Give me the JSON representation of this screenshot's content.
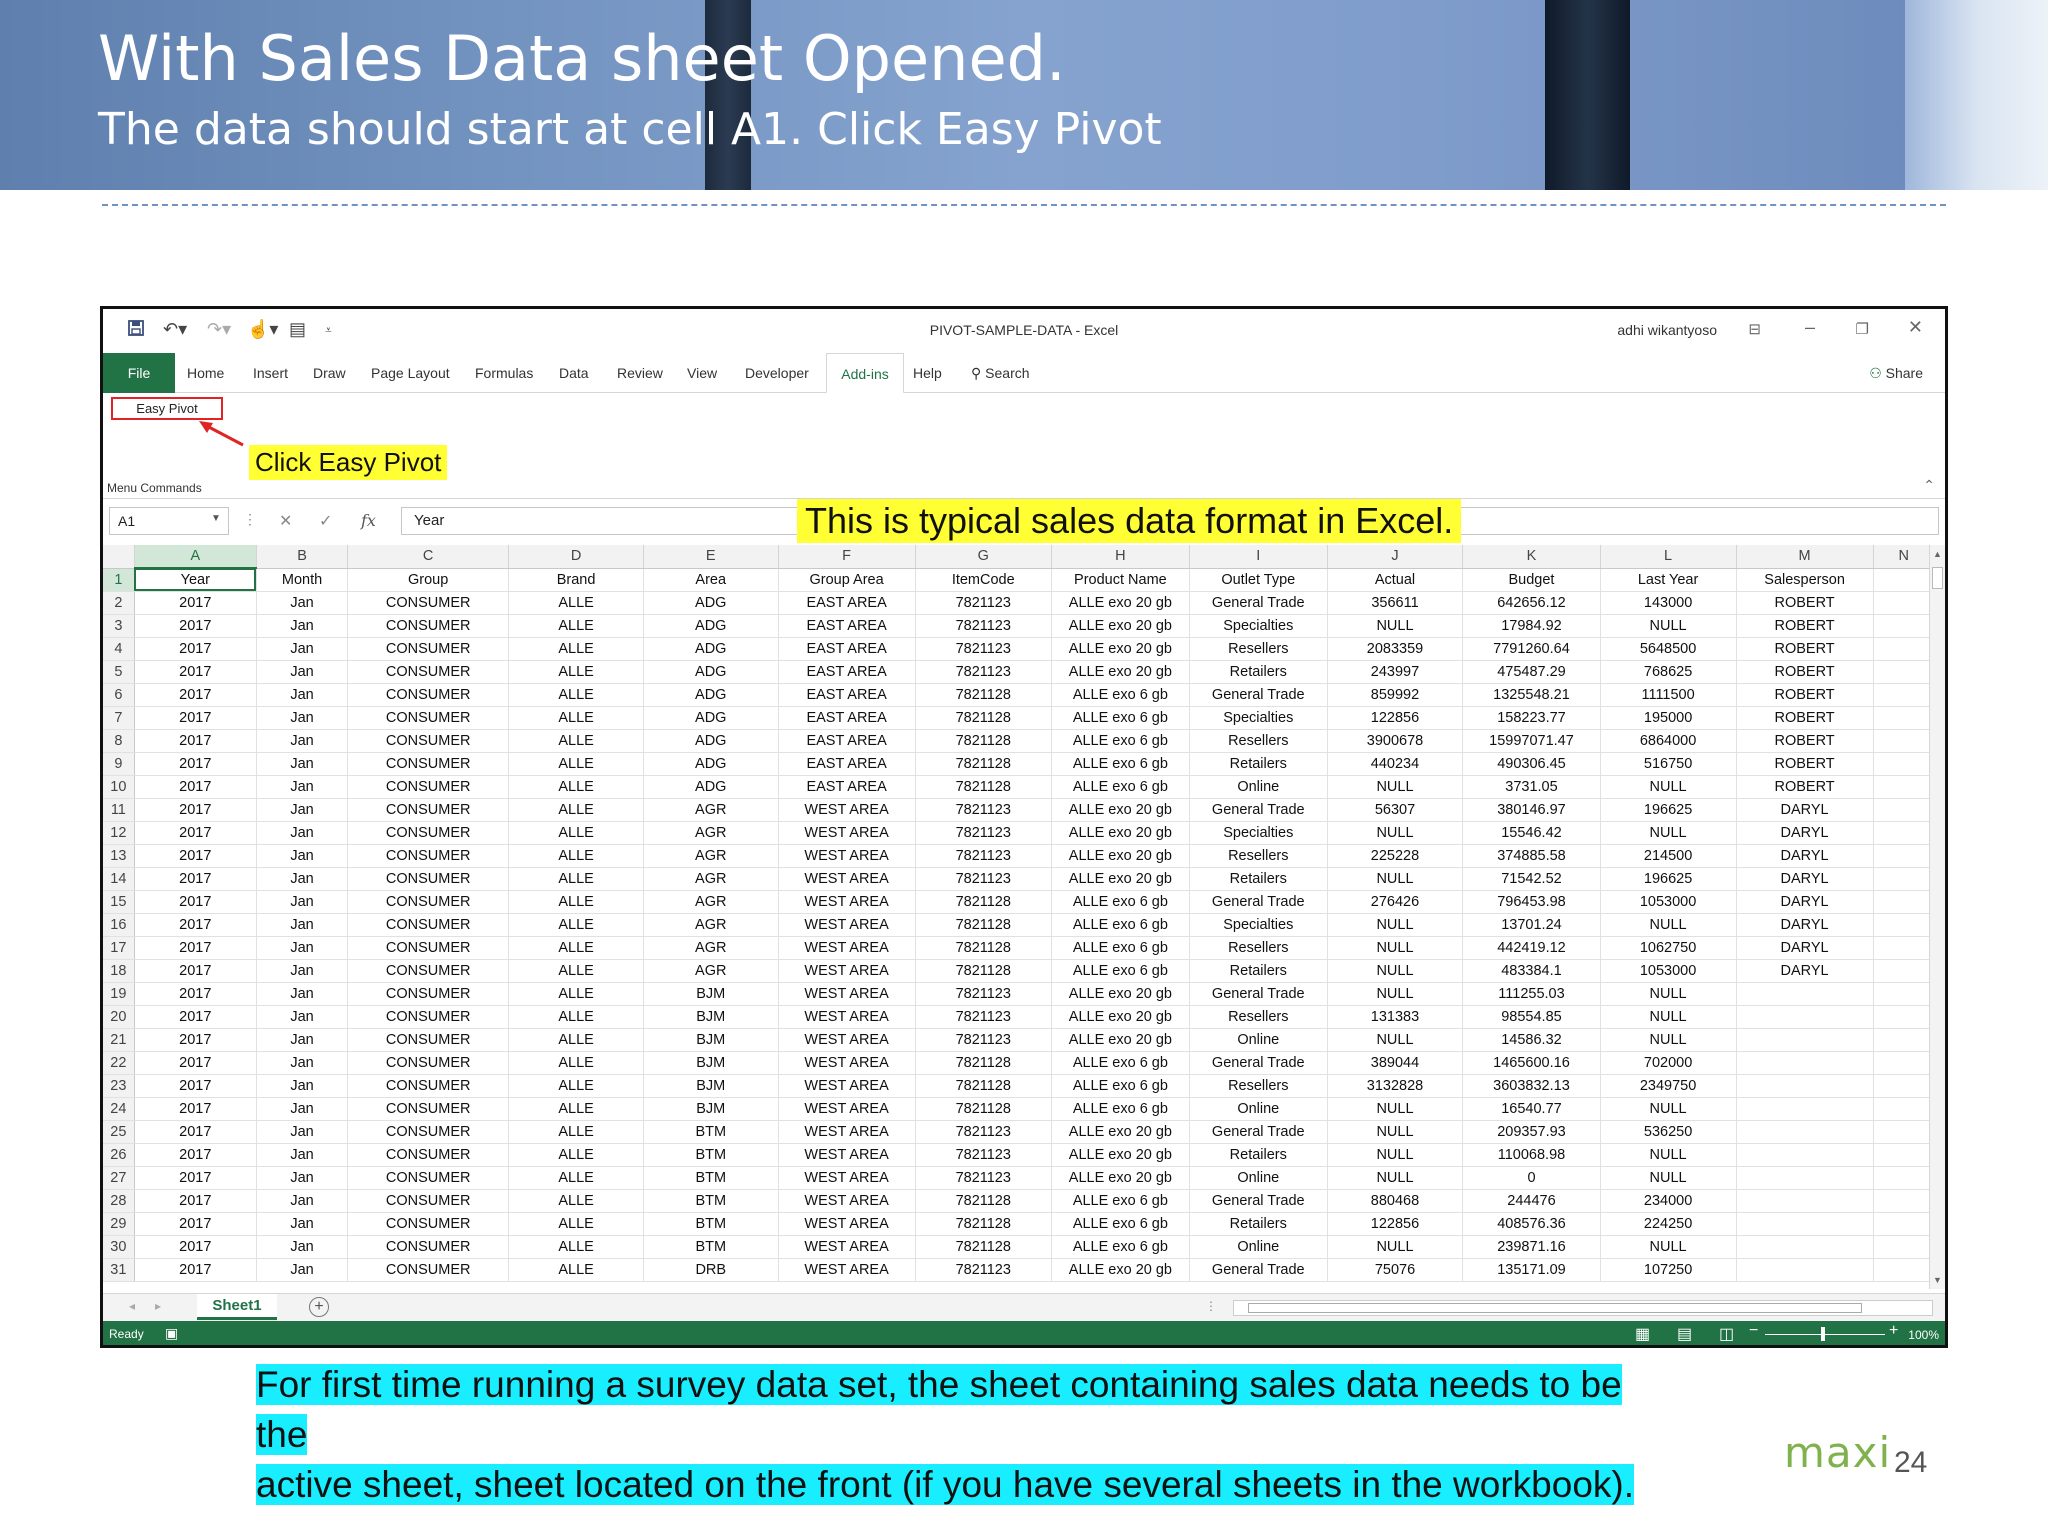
{
  "slide": {
    "title": "With Sales Data sheet Opened.",
    "subtitle": "The data should start at cell A1. Click Easy Pivot",
    "note_line1": "For first time running a survey data set, the sheet containing sales data needs to be the",
    "note_line2": "active sheet, sheet located on the front (if you have several sheets in the workbook).",
    "brand": "maxi",
    "page_number": "24",
    "callout_easy_pivot": "Click Easy Pivot",
    "callout_typical": "This is typical sales data format in Excel.",
    "colors": {
      "highlight_yellow": "#ffff33",
      "highlight_cyan": "#18eeff",
      "excel_green": "#217346",
      "callout_red": "#e02424"
    }
  },
  "excel": {
    "window_title": "PIVOT-SAMPLE-DATA  -  Excel",
    "user": "adhi wikantyoso",
    "tabs": [
      "File",
      "Home",
      "Insert",
      "Draw",
      "Page Layout",
      "Formulas",
      "Data",
      "Review",
      "View",
      "Developer",
      "Add-ins",
      "Help"
    ],
    "active_tab": "Add-ins",
    "search_label": "Search",
    "share_label": "Share",
    "ribbon_button": "Easy Pivot",
    "ribbon_group": "Menu Commands",
    "name_box": "A1",
    "formula_value": "Year",
    "sheet_tab": "Sheet1",
    "status": "Ready",
    "zoom": "100%",
    "icons": [
      "save-icon",
      "undo-icon",
      "redo-icon",
      "touch-mode-icon",
      "form-icon",
      "customize-icon",
      "ribbon-options-icon",
      "minimize-icon",
      "restore-icon",
      "close-icon",
      "share-icon",
      "search-icon",
      "cancel-icon",
      "enter-icon",
      "function-icon",
      "add-sheet-icon"
    ]
  },
  "grid": {
    "column_letters": [
      "A",
      "B",
      "C",
      "D",
      "E",
      "F",
      "G",
      "H",
      "I",
      "J",
      "K",
      "L",
      "M",
      "N"
    ],
    "headers": [
      "Year",
      "Month",
      "Group",
      "Brand",
      "Area",
      "Group Area",
      "ItemCode",
      "Product Name",
      "Outlet Type",
      "Actual",
      "Budget",
      "Last Year",
      "Salesperson"
    ],
    "rows": [
      [
        "2017",
        "Jan",
        "CONSUMER",
        "ALLE",
        "ADG",
        "EAST AREA",
        "7821123",
        "ALLE exo 20 gb",
        "General Trade",
        "356611",
        "642656.12",
        "143000",
        "ROBERT"
      ],
      [
        "2017",
        "Jan",
        "CONSUMER",
        "ALLE",
        "ADG",
        "EAST AREA",
        "7821123",
        "ALLE exo 20 gb",
        "Specialties",
        "NULL",
        "17984.92",
        "NULL",
        "ROBERT"
      ],
      [
        "2017",
        "Jan",
        "CONSUMER",
        "ALLE",
        "ADG",
        "EAST AREA",
        "7821123",
        "ALLE exo 20 gb",
        "Resellers",
        "2083359",
        "7791260.64",
        "5648500",
        "ROBERT"
      ],
      [
        "2017",
        "Jan",
        "CONSUMER",
        "ALLE",
        "ADG",
        "EAST AREA",
        "7821123",
        "ALLE exo 20 gb",
        "Retailers",
        "243997",
        "475487.29",
        "768625",
        "ROBERT"
      ],
      [
        "2017",
        "Jan",
        "CONSUMER",
        "ALLE",
        "ADG",
        "EAST AREA",
        "7821128",
        "ALLE exo 6 gb",
        "General Trade",
        "859992",
        "1325548.21",
        "1111500",
        "ROBERT"
      ],
      [
        "2017",
        "Jan",
        "CONSUMER",
        "ALLE",
        "ADG",
        "EAST AREA",
        "7821128",
        "ALLE exo 6 gb",
        "Specialties",
        "122856",
        "158223.77",
        "195000",
        "ROBERT"
      ],
      [
        "2017",
        "Jan",
        "CONSUMER",
        "ALLE",
        "ADG",
        "EAST AREA",
        "7821128",
        "ALLE exo 6 gb",
        "Resellers",
        "3900678",
        "15997071.47",
        "6864000",
        "ROBERT"
      ],
      [
        "2017",
        "Jan",
        "CONSUMER",
        "ALLE",
        "ADG",
        "EAST AREA",
        "7821128",
        "ALLE exo 6 gb",
        "Retailers",
        "440234",
        "490306.45",
        "516750",
        "ROBERT"
      ],
      [
        "2017",
        "Jan",
        "CONSUMER",
        "ALLE",
        "ADG",
        "EAST AREA",
        "7821128",
        "ALLE exo 6 gb",
        "Online",
        "NULL",
        "3731.05",
        "NULL",
        "ROBERT"
      ],
      [
        "2017",
        "Jan",
        "CONSUMER",
        "ALLE",
        "AGR",
        "WEST AREA",
        "7821123",
        "ALLE exo 20 gb",
        "General Trade",
        "56307",
        "380146.97",
        "196625",
        "DARYL"
      ],
      [
        "2017",
        "Jan",
        "CONSUMER",
        "ALLE",
        "AGR",
        "WEST AREA",
        "7821123",
        "ALLE exo 20 gb",
        "Specialties",
        "NULL",
        "15546.42",
        "NULL",
        "DARYL"
      ],
      [
        "2017",
        "Jan",
        "CONSUMER",
        "ALLE",
        "AGR",
        "WEST AREA",
        "7821123",
        "ALLE exo 20 gb",
        "Resellers",
        "225228",
        "374885.58",
        "214500",
        "DARYL"
      ],
      [
        "2017",
        "Jan",
        "CONSUMER",
        "ALLE",
        "AGR",
        "WEST AREA",
        "7821123",
        "ALLE exo 20 gb",
        "Retailers",
        "NULL",
        "71542.52",
        "196625",
        "DARYL"
      ],
      [
        "2017",
        "Jan",
        "CONSUMER",
        "ALLE",
        "AGR",
        "WEST AREA",
        "7821128",
        "ALLE exo 6 gb",
        "General Trade",
        "276426",
        "796453.98",
        "1053000",
        "DARYL"
      ],
      [
        "2017",
        "Jan",
        "CONSUMER",
        "ALLE",
        "AGR",
        "WEST AREA",
        "7821128",
        "ALLE exo 6 gb",
        "Specialties",
        "NULL",
        "13701.24",
        "NULL",
        "DARYL"
      ],
      [
        "2017",
        "Jan",
        "CONSUMER",
        "ALLE",
        "AGR",
        "WEST AREA",
        "7821128",
        "ALLE exo 6 gb",
        "Resellers",
        "NULL",
        "442419.12",
        "1062750",
        "DARYL"
      ],
      [
        "2017",
        "Jan",
        "CONSUMER",
        "ALLE",
        "AGR",
        "WEST AREA",
        "7821128",
        "ALLE exo 6 gb",
        "Retailers",
        "NULL",
        "483384.1",
        "1053000",
        "DARYL"
      ],
      [
        "2017",
        "Jan",
        "CONSUMER",
        "ALLE",
        "BJM",
        "WEST AREA",
        "7821123",
        "ALLE exo 20 gb",
        "General Trade",
        "NULL",
        "111255.03",
        "NULL",
        ""
      ],
      [
        "2017",
        "Jan",
        "CONSUMER",
        "ALLE",
        "BJM",
        "WEST AREA",
        "7821123",
        "ALLE exo 20 gb",
        "Resellers",
        "131383",
        "98554.85",
        "NULL",
        ""
      ],
      [
        "2017",
        "Jan",
        "CONSUMER",
        "ALLE",
        "BJM",
        "WEST AREA",
        "7821123",
        "ALLE exo 20 gb",
        "Online",
        "NULL",
        "14586.32",
        "NULL",
        ""
      ],
      [
        "2017",
        "Jan",
        "CONSUMER",
        "ALLE",
        "BJM",
        "WEST AREA",
        "7821128",
        "ALLE exo 6 gb",
        "General Trade",
        "389044",
        "1465600.16",
        "702000",
        ""
      ],
      [
        "2017",
        "Jan",
        "CONSUMER",
        "ALLE",
        "BJM",
        "WEST AREA",
        "7821128",
        "ALLE exo 6 gb",
        "Resellers",
        "3132828",
        "3603832.13",
        "2349750",
        ""
      ],
      [
        "2017",
        "Jan",
        "CONSUMER",
        "ALLE",
        "BJM",
        "WEST AREA",
        "7821128",
        "ALLE exo 6 gb",
        "Online",
        "NULL",
        "16540.77",
        "NULL",
        ""
      ],
      [
        "2017",
        "Jan",
        "CONSUMER",
        "ALLE",
        "BTM",
        "WEST AREA",
        "7821123",
        "ALLE exo 20 gb",
        "General Trade",
        "NULL",
        "209357.93",
        "536250",
        ""
      ],
      [
        "2017",
        "Jan",
        "CONSUMER",
        "ALLE",
        "BTM",
        "WEST AREA",
        "7821123",
        "ALLE exo 20 gb",
        "Retailers",
        "NULL",
        "110068.98",
        "NULL",
        ""
      ],
      [
        "2017",
        "Jan",
        "CONSUMER",
        "ALLE",
        "BTM",
        "WEST AREA",
        "7821123",
        "ALLE exo 20 gb",
        "Online",
        "NULL",
        "0",
        "NULL",
        ""
      ],
      [
        "2017",
        "Jan",
        "CONSUMER",
        "ALLE",
        "BTM",
        "WEST AREA",
        "7821128",
        "ALLE exo 6 gb",
        "General Trade",
        "880468",
        "244476",
        "234000",
        ""
      ],
      [
        "2017",
        "Jan",
        "CONSUMER",
        "ALLE",
        "BTM",
        "WEST AREA",
        "7821128",
        "ALLE exo 6 gb",
        "Retailers",
        "122856",
        "408576.36",
        "224250",
        ""
      ],
      [
        "2017",
        "Jan",
        "CONSUMER",
        "ALLE",
        "BTM",
        "WEST AREA",
        "7821128",
        "ALLE exo 6 gb",
        "Online",
        "NULL",
        "239871.16",
        "NULL",
        ""
      ],
      [
        "2017",
        "Jan",
        "CONSUMER",
        "ALLE",
        "DRB",
        "WEST AREA",
        "7821123",
        "ALLE exo 20 gb",
        "General Trade",
        "75076",
        "135171.09",
        "107250",
        ""
      ]
    ]
  }
}
